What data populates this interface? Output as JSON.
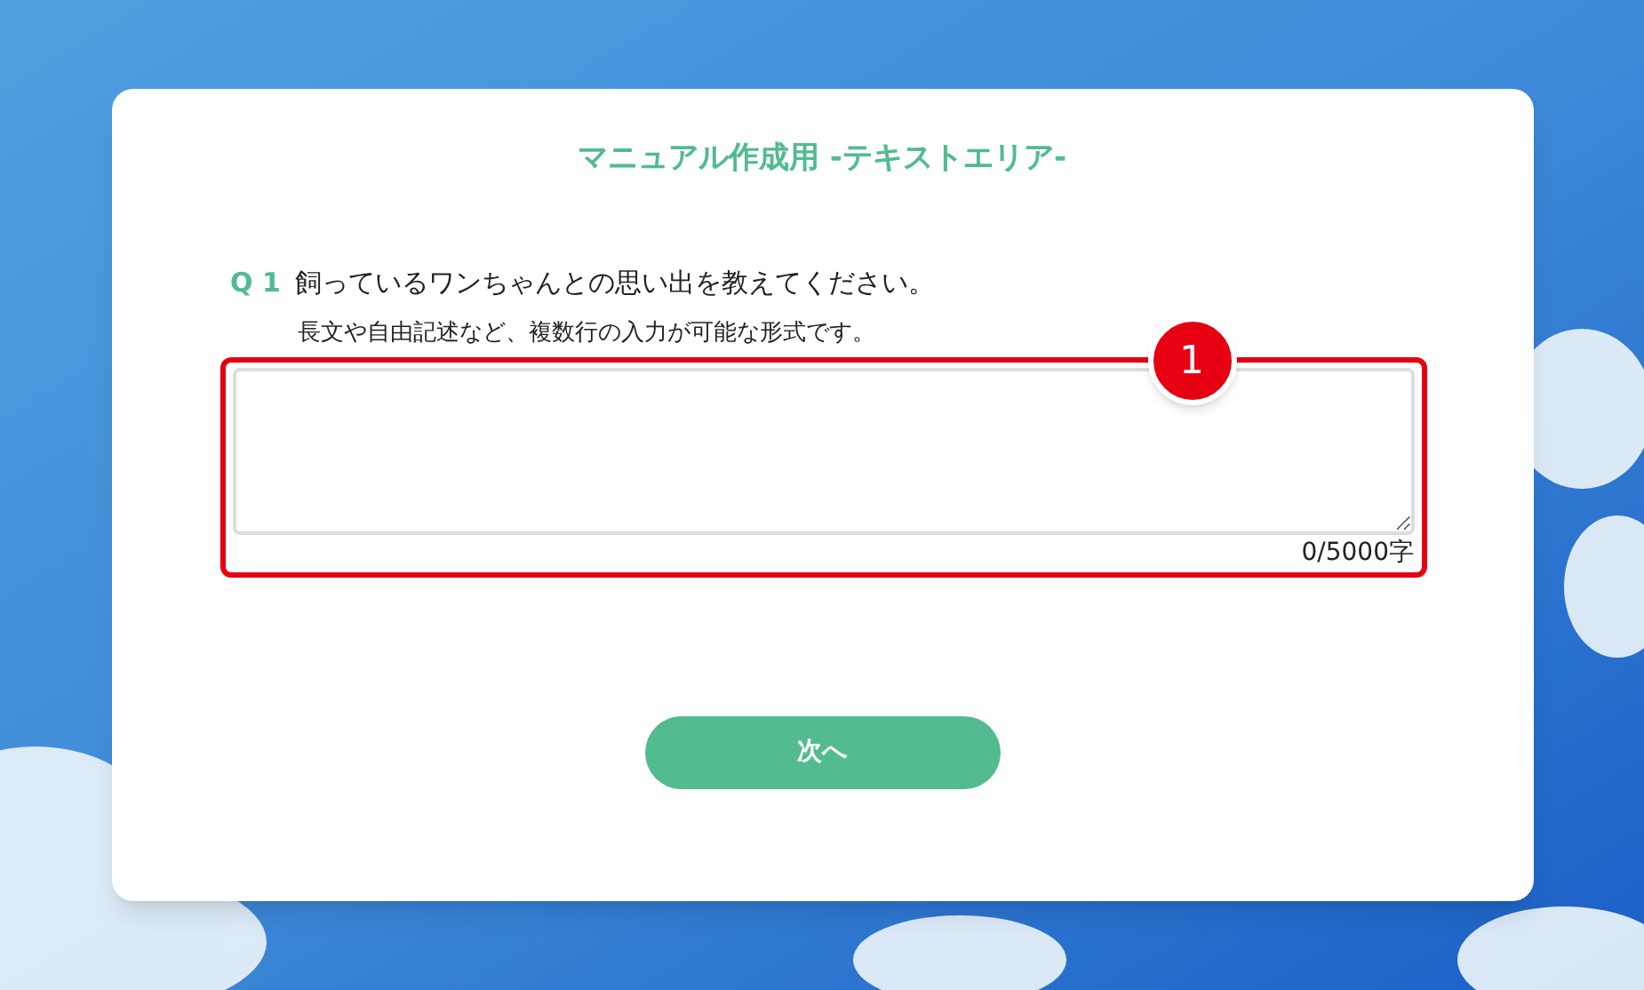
{
  "form": {
    "title": "マニュアル作成用 -テキストエリア-",
    "question": {
      "number": "Q 1",
      "text": "飼っているワンちゃんとの思い出を教えてください。",
      "description": "長文や自由記述など、複数行の入力が可能な形式です。",
      "counter": "0/5000字"
    },
    "next_button": "次へ"
  },
  "annotation": {
    "number": "1"
  }
}
